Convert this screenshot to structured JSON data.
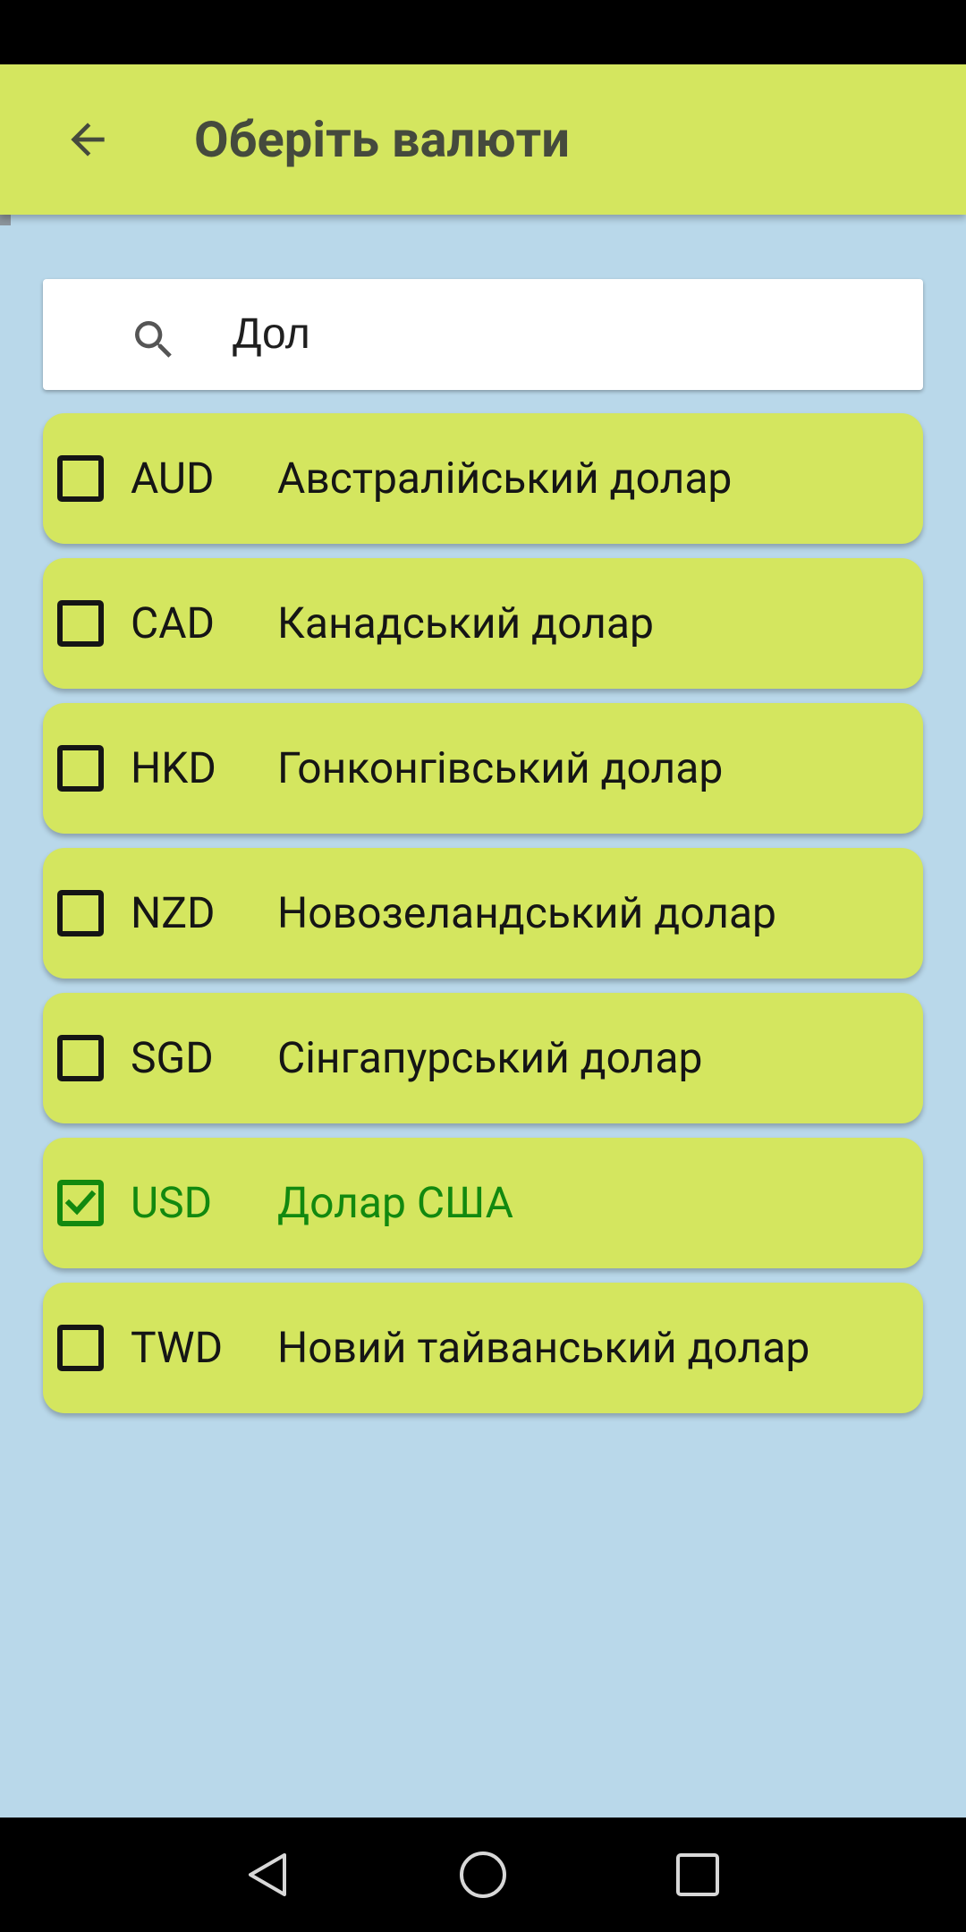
{
  "app_bar": {
    "title": "Оберіть валюти",
    "back_icon": "arrow-back-icon"
  },
  "search": {
    "icon": "search-icon",
    "value": "Дол"
  },
  "currencies": [
    {
      "code": "AUD",
      "name": "Австралійський долар",
      "checked": false
    },
    {
      "code": "CAD",
      "name": "Канадський долар",
      "checked": false
    },
    {
      "code": "HKD",
      "name": "Гонконгівський долар",
      "checked": false
    },
    {
      "code": "NZD",
      "name": "Новозеландський долар",
      "checked": false
    },
    {
      "code": "SGD",
      "name": "Сінгапурський долар",
      "checked": false
    },
    {
      "code": "USD",
      "name": "Долар США",
      "checked": true
    },
    {
      "code": "TWD",
      "name": "Новий тайванський долар",
      "checked": false
    }
  ],
  "colors": {
    "background": "#b9d8ea",
    "app_bar": "#d4e65f",
    "item_background": "#d4e65f",
    "checked_accent": "#12890f",
    "title_text": "#454a3d"
  },
  "nav_bar": {
    "back_icon": "nav-back-triangle-icon",
    "home_icon": "nav-home-circle-icon",
    "recents_icon": "nav-recents-square-icon"
  }
}
